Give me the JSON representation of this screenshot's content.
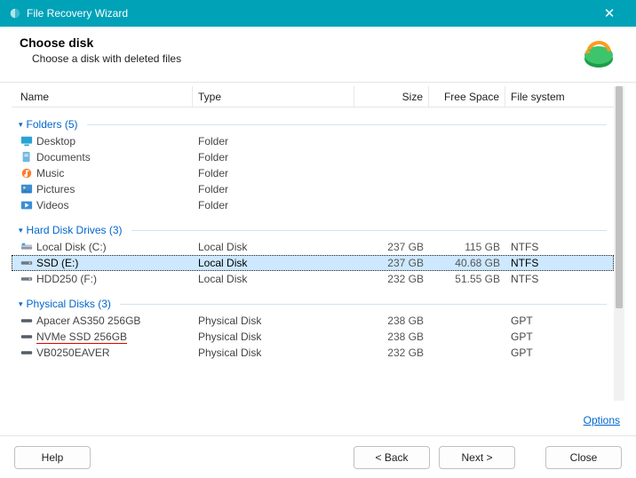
{
  "window": {
    "title": "File Recovery Wizard"
  },
  "header": {
    "title": "Choose disk",
    "subtitle": "Choose a disk with deleted files"
  },
  "columns": {
    "name": "Name",
    "type": "Type",
    "size": "Size",
    "free": "Free Space",
    "fs": "File system"
  },
  "groups": {
    "folders": {
      "label": "Folders (5)"
    },
    "drives": {
      "label": "Hard Disk Drives (3)"
    },
    "physical": {
      "label": "Physical Disks (3)"
    }
  },
  "folders": [
    {
      "name": "Desktop",
      "type": "Folder"
    },
    {
      "name": "Documents",
      "type": "Folder"
    },
    {
      "name": "Music",
      "type": "Folder"
    },
    {
      "name": "Pictures",
      "type": "Folder"
    },
    {
      "name": "Videos",
      "type": "Folder"
    }
  ],
  "drives": [
    {
      "name": "Local Disk (C:)",
      "type": "Local Disk",
      "size": "237 GB",
      "free": "115 GB",
      "fs": "NTFS"
    },
    {
      "name": "SSD (E:)",
      "type": "Local Disk",
      "size": "237 GB",
      "free": "40.68 GB",
      "fs": "NTFS"
    },
    {
      "name": "HDD250 (F:)",
      "type": "Local Disk",
      "size": "232 GB",
      "free": "51.55 GB",
      "fs": "NTFS"
    }
  ],
  "physical": [
    {
      "name": "Apacer AS350 256GB",
      "type": "Physical Disk",
      "size": "238 GB",
      "fs": "GPT"
    },
    {
      "name": "NVMe SSD 256GB",
      "type": "Physical Disk",
      "size": "238 GB",
      "fs": "GPT"
    },
    {
      "name": "VB0250EAVER",
      "type": "Physical Disk",
      "size": "232 GB",
      "fs": "GPT"
    }
  ],
  "links": {
    "options": "Options"
  },
  "buttons": {
    "help": "Help",
    "back": "< Back",
    "next": "Next >",
    "close": "Close"
  }
}
